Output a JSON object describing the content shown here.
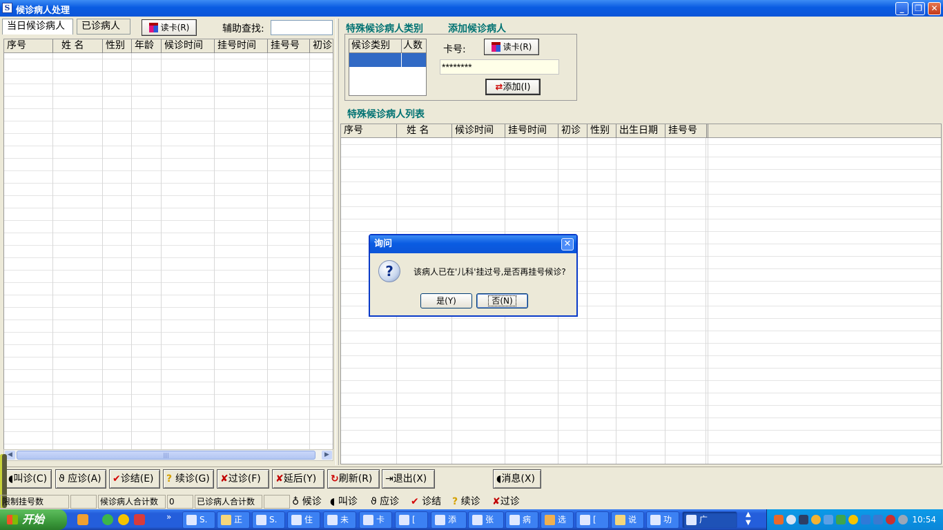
{
  "window": {
    "title": "候诊病人处理",
    "controls": [
      "_",
      "❐",
      "✕"
    ]
  },
  "tabs": [
    {
      "label": "当日候诊病人"
    },
    {
      "label": "已诊病人"
    }
  ],
  "read_card_label": "读卡(R)",
  "assist_search": {
    "label": "辅助查找:",
    "value": ""
  },
  "left_grid": {
    "columns": [
      "序号",
      "姓 名",
      "性别",
      "年龄",
      "候诊时间",
      "挂号时间",
      "挂号号",
      "初诊"
    ]
  },
  "special_section": {
    "category_title": "特殊候诊病人类别",
    "add_title": "添加候诊病人",
    "category_columns": [
      "候诊类别",
      "人数"
    ],
    "card_label": "卡号:",
    "card_value": "********",
    "add_button": "添加(I)",
    "list_title": "特殊候诊病人列表",
    "list_columns": [
      "序号",
      "姓 名",
      "候诊时间",
      "挂号时间",
      "初诊",
      "性别",
      "出生日期",
      "挂号号"
    ]
  },
  "bottom_buttons": [
    {
      "label": "叫诊(C)",
      "icon": "speaker-icon"
    },
    {
      "label": "应诊(A)",
      "icon": "stethoscope-icon"
    },
    {
      "label": "诊结(E)",
      "icon": "check-icon"
    },
    {
      "label": "续诊(G)",
      "icon": "question-icon"
    },
    {
      "label": "过诊(F)",
      "icon": "cross-icon"
    },
    {
      "label": "延后(Y)",
      "icon": "cross-icon"
    },
    {
      "label": "刷新(R)",
      "icon": "refresh-icon"
    },
    {
      "label": "退出(X)",
      "icon": "exit-icon"
    },
    {
      "label": "消息(X)",
      "icon": "speaker-icon"
    }
  ],
  "status": {
    "limit_label": "限制挂号数",
    "limit_value": "",
    "waiting_total_label": "候诊病人合计数",
    "waiting_total_value": "0",
    "seen_total_label": "已诊病人合计数",
    "seen_total_value": "",
    "legend": [
      "候诊",
      "叫诊",
      "应诊",
      "诊结",
      "续诊",
      "过诊"
    ]
  },
  "dialog": {
    "title": "询问",
    "message": "该病人已在'儿科'挂过号,是否再挂号候诊?",
    "yes": "是(Y)",
    "no": "否(N)"
  },
  "taskbar": {
    "start_label": "开始",
    "tasks": [
      "S.",
      "正",
      "S.",
      "住",
      "未",
      "卡",
      "[",
      "添",
      "张",
      "病",
      "选",
      "[",
      "说",
      "功",
      "广"
    ],
    "clock": "10:54"
  }
}
